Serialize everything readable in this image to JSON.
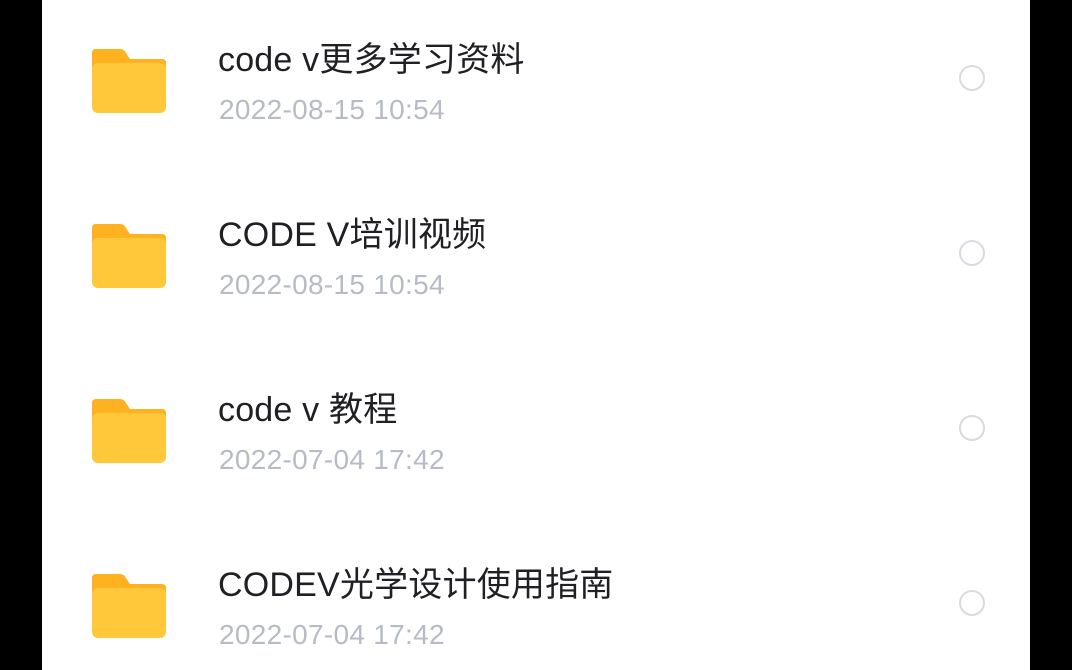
{
  "colors": {
    "folder_body": "#FFC83A",
    "folder_tab": "#FFB21F",
    "name_text": "#1f1f24",
    "date_text": "#b7bbc6",
    "radio_border": "#d9dbe1"
  },
  "files": [
    {
      "name": "code v更多学习资料",
      "modified": "2022-08-15 10:54",
      "icon": "folder-icon"
    },
    {
      "name": "CODE V培训视频",
      "modified": "2022-08-15 10:54",
      "icon": "folder-icon"
    },
    {
      "name": "code v 教程",
      "modified": "2022-07-04 17:42",
      "icon": "folder-icon"
    },
    {
      "name": "CODEV光学设计使用指南",
      "modified": "2022-07-04 17:42",
      "icon": "folder-icon"
    }
  ]
}
